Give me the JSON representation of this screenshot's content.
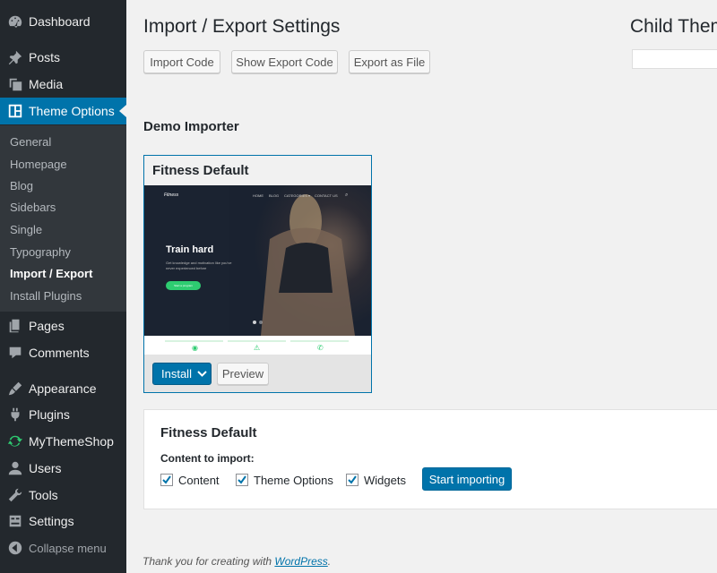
{
  "sidebar": {
    "items": [
      {
        "label": "Dashboard",
        "icon": "dashboard-icon"
      },
      {
        "label": "Posts",
        "icon": "pin-icon"
      },
      {
        "label": "Media",
        "icon": "media-icon"
      },
      {
        "label": "Theme Options",
        "icon": "theme-options-icon",
        "active": true
      },
      {
        "label": "Pages",
        "icon": "pages-icon"
      },
      {
        "label": "Comments",
        "icon": "comments-icon"
      },
      {
        "label": "Appearance",
        "icon": "brush-icon"
      },
      {
        "label": "Plugins",
        "icon": "plugin-icon"
      },
      {
        "label": "MyThemeShop",
        "icon": "refresh-icon"
      },
      {
        "label": "Users",
        "icon": "user-icon"
      },
      {
        "label": "Tools",
        "icon": "wrench-icon"
      },
      {
        "label": "Settings",
        "icon": "settings-icon"
      }
    ],
    "submenu": [
      "General",
      "Homepage",
      "Blog",
      "Sidebars",
      "Single",
      "Typography",
      "Import / Export",
      "Install Plugins"
    ],
    "submenu_current": "Import / Export",
    "collapse_label": "Collapse menu"
  },
  "main": {
    "title": "Import / Export Settings",
    "buttons": {
      "import_code": "Import Code",
      "show_export": "Show Export Code",
      "export_file": "Export as File"
    },
    "right_title": "Child Theme",
    "demo_heading": "Demo Importer",
    "demo_card": {
      "title": "Fitness Default",
      "preview": {
        "logo": "Fitness",
        "nav": [
          "HOME",
          "BLOG",
          "CATEGORIES ▾",
          "CONTACT US"
        ],
        "headline": "Train hard",
        "subtext": "Get knowledge and motivation like you've never experienced before",
        "cta": "Start a program"
      },
      "install_label": "Install",
      "preview_label": "Preview"
    },
    "import_panel": {
      "title": "Fitness Default",
      "content_label": "Content to import:",
      "options": [
        {
          "label": "Content",
          "checked": true
        },
        {
          "label": "Theme Options",
          "checked": true
        },
        {
          "label": "Widgets",
          "checked": true
        }
      ],
      "start_label": "Start importing"
    },
    "footer": {
      "prefix": "Thank you for creating with ",
      "link": "WordPress",
      "suffix": "."
    }
  },
  "colors": {
    "accent": "#0073aa",
    "sidebar_bg": "#23282d",
    "submenu_bg": "#32373c",
    "cta_green": "#2ecc71"
  }
}
